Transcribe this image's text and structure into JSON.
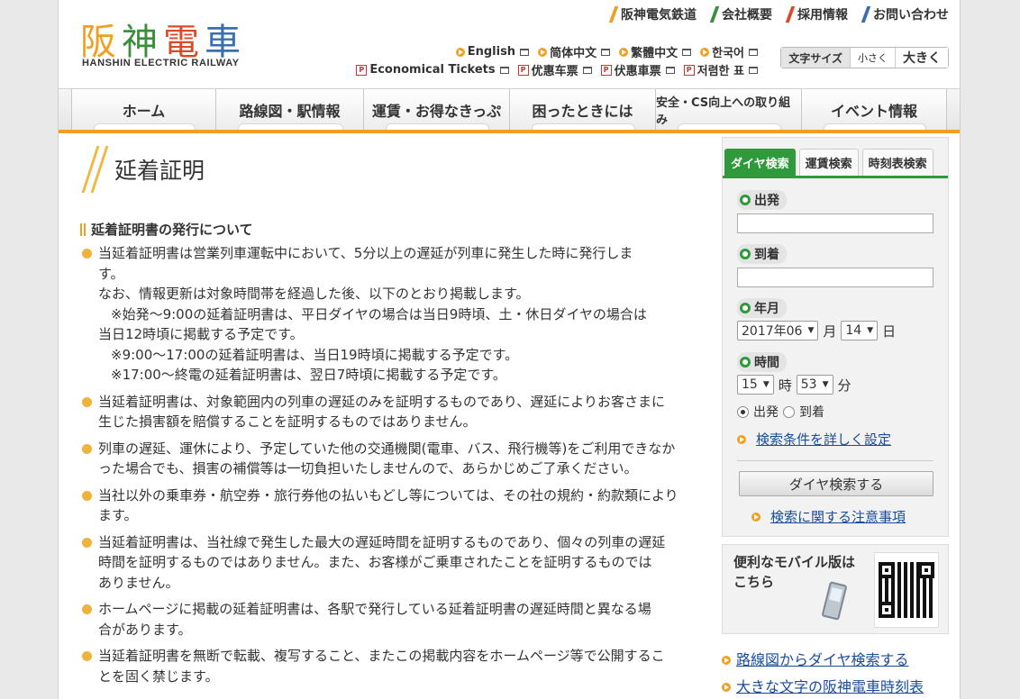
{
  "header": {
    "logo_jp": [
      "阪",
      "神",
      "電",
      "車"
    ],
    "logo_en": "HANSHIN ELECTRIC RAILWAY",
    "top_links": [
      {
        "label": "阪神電気鉄道",
        "color": "#f0a020"
      },
      {
        "label": "会社概要",
        "color": "#3b8f3b"
      },
      {
        "label": "採用情報",
        "color": "#d94c2b"
      },
      {
        "label": "お問い合わせ",
        "color": "#3a6fb0"
      }
    ],
    "languages": [
      "English",
      "简体中文",
      "繁體中文",
      "한국어"
    ],
    "tickets": [
      "Economical Tickets",
      "优惠车票",
      "伏惠車票",
      "저렴한 표"
    ],
    "font_size": {
      "label": "文字サイズ",
      "small": "小さく",
      "large": "大きく"
    }
  },
  "nav": [
    {
      "label": "ホーム"
    },
    {
      "label": "路線図・駅情報"
    },
    {
      "label": "運賃・お得なきっぷ"
    },
    {
      "label": "困ったときには"
    },
    {
      "label": "安全・CS向上への取り組み"
    },
    {
      "label": "イベント情報"
    }
  ],
  "main": {
    "title": "延着証明",
    "section_title": "延着証明書の発行について",
    "items": [
      {
        "lines": [
          "当延着証明書は営業列車運転中において、5分以上の遅延が列車に発生した時に発行しま",
          "す。",
          "なお、情報更新は対象時間帯を経過した後、以下のとおり掲載します。"
        ],
        "indented": [
          "※始発～9:00の延着証明書は、平日ダイヤの場合は当日9時頃、土・休日ダイヤの場合は"
        ],
        "after": [
          "当日12時頃に掲載する予定です。"
        ],
        "indented2": [
          "※9:00～17:00の延着証明書は、当日19時頃に掲載する予定です。",
          "※17:00～終電の延着証明書は、翌日7時頃に掲載する予定です。"
        ]
      },
      {
        "lines": [
          "当延着証明書は、対象範囲内の列車の遅延のみを証明するものであり、遅延によりお客さまに",
          "生じた損害額を賠償することを証明するものではありません。"
        ]
      },
      {
        "lines": [
          "列車の遅延、運休により、予定していた他の交通機関(電車、バス、飛行機等)をご利用できなか",
          "った場合でも、損害の補償等は一切負担いたしませんので、あらかじめご了承ください。"
        ]
      },
      {
        "lines": [
          "当社以外の乗車券・航空券・旅行券他の払いもどし等については、その社の規約・約款類により",
          "ます。"
        ]
      },
      {
        "lines": [
          "当延着証明書は、当社線で発生した最大の遅延時間を証明するものであり、個々の列車の遅延",
          "時間を証明するものではありません。また、お客様がご乗車されたことを証明するものでは",
          "ありません。"
        ]
      },
      {
        "lines": [
          "ホームページに掲載の延着証明書は、各駅で発行している延着証明書の遅延時間と異なる場",
          "合があります。"
        ]
      },
      {
        "lines": [
          "当延着証明書を無断で転載、複写すること、またこの掲載内容をホームページ等で公開するこ",
          "とを固く禁じます。"
        ]
      }
    ]
  },
  "sidebar": {
    "tabs": [
      "ダイヤ検索",
      "運賃検索",
      "時刻表検索"
    ],
    "depart_label": "出発",
    "arrive_label": "到着",
    "date_label": "年月",
    "year_month": "2017年06",
    "month_unit": "月",
    "day": "14",
    "day_unit": "日",
    "time_label": "時間",
    "hour": "15",
    "hour_unit": "時",
    "minute": "53",
    "minute_unit": "分",
    "radio_depart": "出発",
    "radio_arrive": "到着",
    "detail_link": "検索条件を詳しく設定",
    "search_button": "ダイヤ検索する",
    "notes_link": "検索に関する注意事項",
    "mobile_text": [
      "便利なモバイル版は",
      "こちら"
    ],
    "links": [
      "路線図からダイヤ検索する",
      "大きな文字の阪神電車時刻表"
    ]
  },
  "colors": {
    "accent": "#f0a020",
    "green": "#2f9a3c",
    "link": "#1a4c9a"
  }
}
